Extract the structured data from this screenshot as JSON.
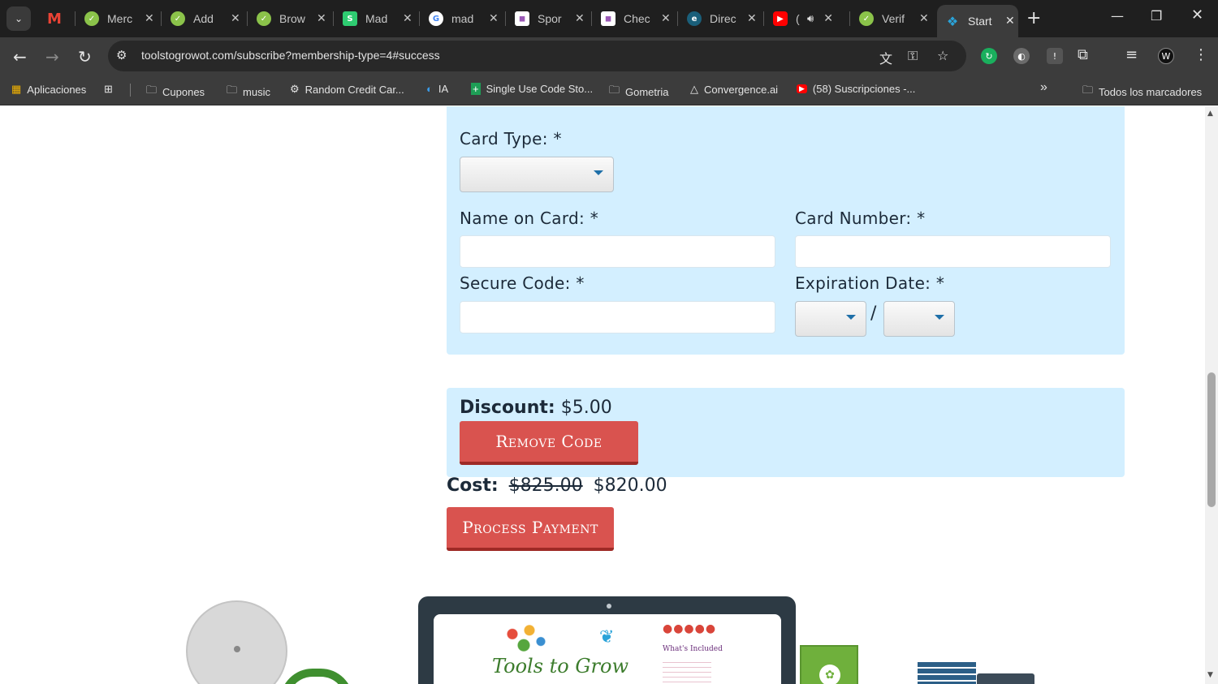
{
  "tabs": [
    {
      "icon": "gmail-icon",
      "title": "",
      "color": "#ea4335"
    },
    {
      "icon": "growot-icon",
      "title": "Merc",
      "color": "#8bc34a"
    },
    {
      "icon": "growot-icon",
      "title": "Add",
      "color": "#8bc34a"
    },
    {
      "icon": "growot-icon",
      "title": "Brow",
      "color": "#8bc34a"
    },
    {
      "icon": "s-icon",
      "title": "Mad",
      "color": "#2ecc71"
    },
    {
      "icon": "google-icon",
      "title": "mad",
      "color": "#4285f4"
    },
    {
      "icon": "spot-icon",
      "title": "Spor",
      "color": "#9b59b6"
    },
    {
      "icon": "check-icon",
      "title": "Chec",
      "color": "#9b59b6"
    },
    {
      "icon": "direct-icon",
      "title": "Direc",
      "color": "#1a7fa6"
    },
    {
      "icon": "youtube-icon",
      "title": "(",
      "color": "#ff0000"
    },
    {
      "icon": "growot-icon",
      "title": "Verif",
      "color": "#8bc34a"
    },
    {
      "icon": "tools-icon",
      "title": "Start",
      "color": "#2aa3d9"
    }
  ],
  "address_bar": {
    "url": "toolstogrowot.com/subscribe?membership-type=4#success"
  },
  "bookmarks": [
    {
      "label": "Aplicaciones",
      "icon": "apps-grid-icon"
    },
    {
      "label": "",
      "icon": "tab-groups-icon"
    },
    {
      "label": "Cupones",
      "icon": "folder-icon"
    },
    {
      "label": "music",
      "icon": "folder-icon"
    },
    {
      "label": "Random Credit Car...",
      "icon": "gear-icon"
    },
    {
      "label": "IA",
      "icon": "edge-icon"
    },
    {
      "label": "Single Use Code Sto...",
      "icon": "plus-icon"
    },
    {
      "label": "Gometria",
      "icon": "folder-icon"
    },
    {
      "label": "Convergence.ai",
      "icon": "triangle-icon"
    },
    {
      "label": "(58) Suscripciones -...",
      "icon": "youtube-icon"
    },
    {
      "label": "Todos los marcadores",
      "icon": "folder-icon"
    }
  ],
  "form": {
    "card_type_label": "Card Type: *",
    "name_label": "Name on Card: *",
    "number_label": "Card Number: *",
    "code_label": "Secure Code: *",
    "expiration_label": "Expiration Date: *",
    "expiration_separator": "/"
  },
  "discount": {
    "label": "Discount:",
    "amount": "$5.00",
    "remove_button": "Remove Code"
  },
  "cost": {
    "label": "Cost:",
    "original": "$825.00",
    "final": "$820.00"
  },
  "process_button": "Process Payment",
  "promo": {
    "logo_text": "Tools to Grow",
    "included_text": "What's Included"
  },
  "colors": {
    "panel": "#d3efff",
    "button": "#d9534f",
    "text": "#1c2a39"
  }
}
